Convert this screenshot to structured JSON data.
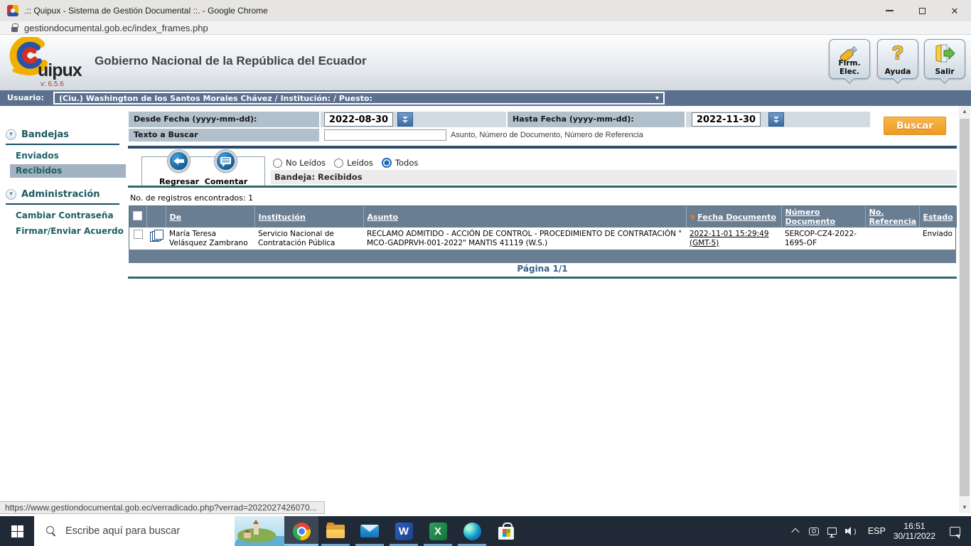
{
  "browser": {
    "window_title": ".:: Quipux - Sistema de Gestión Documental ::. - Google Chrome",
    "url": "gestiondocumental.gob.ec/index_frames.php",
    "status_link": "https://www.gestiondocumental.gob.ec/verradicado.php?verrad=2022027426070..."
  },
  "header": {
    "logo_text": "uipux",
    "version": "v: 6.5.6",
    "title": "Gobierno Nacional de la República del Ecuador",
    "buttons": {
      "firm": "Firm. Elec.",
      "ayuda": "Ayuda",
      "salir": "Salir"
    }
  },
  "user_bar": {
    "label": "Usuario:",
    "value": "(Ciu.) Washington de los Santos Morales Chávez / Institución: / Puesto:"
  },
  "sidebar": {
    "bandejas_title": "Bandejas",
    "bandejas_items": [
      "Enviados",
      "Recibidos"
    ],
    "admin_title": "Administración",
    "admin_items": [
      "Cambiar Contraseña",
      "Firmar/Enviar Acuerdo"
    ],
    "active_item": "Recibidos"
  },
  "search_form": {
    "from_label": "Desde Fecha (yyyy-mm-dd):",
    "from_value": "2022-08-30",
    "to_label": "Hasta Fecha (yyyy-mm-dd):",
    "to_value": "2022-11-30",
    "text_label": "Texto a Buscar",
    "text_value": "",
    "text_hint": "Asunto, Número de Documento, Número de Referencia",
    "search_button": "Buscar"
  },
  "toolbar": {
    "back_label": "Regresar",
    "comment_label": "Comentar",
    "filters": [
      {
        "label": "No Leídos",
        "checked": false
      },
      {
        "label": "Leídos",
        "checked": false
      },
      {
        "label": "Todos",
        "checked": true
      }
    ],
    "bandeja_label": "Bandeja: Recibidos"
  },
  "results": {
    "count_label": "No. de registros encontrados: 1",
    "columns": {
      "de": "De",
      "institucion": "Institución",
      "asunto": "Asunto",
      "fecha": "Fecha Documento",
      "numero": "Número Documento",
      "referencia": "No. Referencia",
      "estado": "Estado"
    },
    "rows": [
      {
        "de": "María Teresa Velásquez Zambrano",
        "institucion": "Servicio Nacional de Contratación Pública",
        "asunto": "RECLAMO ADMITIDO - ACCIÓN DE CONTROL - PROCEDIMIENTO DE CONTRATACIÓN \" MCO-GADPRVH-001-2022\" MANTIS 41119 (W.S.)",
        "fecha": "2022-11-01 15:29:49 (GMT-5)",
        "numero": "SERCOP-CZ4-2022-1695-OF",
        "referencia": "",
        "estado": "Enviado"
      }
    ],
    "pagination": "Página 1/1"
  },
  "taskbar": {
    "search_placeholder": "Escribe aquí para buscar",
    "language": "ESP",
    "time": "16:51",
    "date": "30/11/2022"
  },
  "icons": {
    "sort_desc": "▼",
    "select_chevron": "▾",
    "collapse_chevron": "▾",
    "scroll_up": "▲",
    "scroll_down": "▼",
    "close": "✕"
  },
  "colors": {
    "accent_orange": "#f2a12d",
    "slate_header": "#697d93",
    "user_bar": "#5b708f",
    "teal_rule": "#2e696c",
    "sidebar_text": "#1d6064",
    "radio_checked": "#1867c0"
  }
}
